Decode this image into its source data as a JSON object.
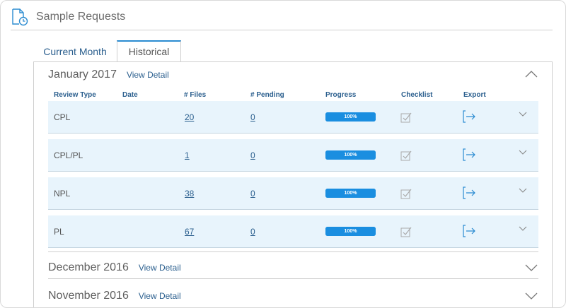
{
  "header": {
    "title": "Sample Requests",
    "icon": "document-clock-icon"
  },
  "tabs": [
    {
      "label": "Current Month",
      "active": false
    },
    {
      "label": "Historical",
      "active": true
    }
  ],
  "accent_color": "#2b5f8e",
  "progress_color": "#1a8ee0",
  "months": [
    {
      "name": "January 2017",
      "view_detail": "View Detail",
      "expanded": true
    },
    {
      "name": "December 2016",
      "view_detail": "View Detail",
      "expanded": false
    },
    {
      "name": "November 2016",
      "view_detail": "View Detail",
      "expanded": false
    }
  ],
  "table": {
    "columns": [
      "Review Type",
      "Date",
      "# Files",
      "# Pending",
      "Progress",
      "Checklist",
      "Export"
    ],
    "rows": [
      {
        "type": "CPL",
        "files": "20",
        "pending": "0",
        "progress": 1.0,
        "progress_label": "100%"
      },
      {
        "type": "CPL/PL",
        "files": "1",
        "pending": "0",
        "progress": 1.0,
        "progress_label": "100%"
      },
      {
        "type": "NPL",
        "files": "38",
        "pending": "0",
        "progress": 1.0,
        "progress_label": "100%"
      },
      {
        "type": "PL",
        "files": "67",
        "pending": "0",
        "progress": 1.0,
        "progress_label": "100%"
      }
    ]
  }
}
